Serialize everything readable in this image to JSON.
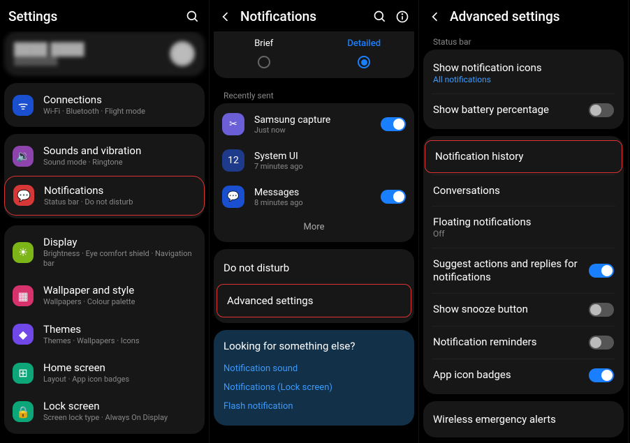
{
  "screen1": {
    "title": "Settings",
    "profile": {
      "name": "████ ████",
      "sub": "████████"
    },
    "items": [
      {
        "title": "Connections",
        "sub": "Wi-Fi  ·  Bluetooth  ·  Flight mode"
      },
      {
        "title": "Sounds and vibration",
        "sub": "Sound mode  ·  Ringtone"
      },
      {
        "title": "Notifications",
        "sub": "Status bar  ·  Do not disturb"
      },
      {
        "title": "Display",
        "sub": "Brightness  ·  Eye comfort shield  ·  Navigation bar"
      },
      {
        "title": "Wallpaper and style",
        "sub": "Wallpapers  ·  Colour palette"
      },
      {
        "title": "Themes",
        "sub": "Themes  ·  Wallpapers  ·  Icons"
      },
      {
        "title": "Home screen",
        "sub": "Layout  ·  App icon badges"
      },
      {
        "title": "Lock screen",
        "sub": "Screen lock type  ·  Always On Display"
      }
    ]
  },
  "screen2": {
    "title": "Notifications",
    "style": {
      "brief": "Brief",
      "detailed": "Detailed"
    },
    "recently_sent_label": "Recently sent",
    "recent": [
      {
        "title": "Samsung capture",
        "sub": "Just now",
        "on": true
      },
      {
        "title": "System UI",
        "sub": "7 minutes ago",
        "on": null
      },
      {
        "title": "Messages",
        "sub": "8 minutes ago",
        "on": true
      }
    ],
    "more": "More",
    "do_not_disturb": "Do not disturb",
    "advanced": "Advanced settings",
    "lookingfor_title": "Looking for something else?",
    "links": [
      "Notification sound",
      "Notifications (Lock screen)",
      "Flash notification"
    ]
  },
  "screen3": {
    "title": "Advanced settings",
    "status_bar_label": "Status bar",
    "items": {
      "show_icons": {
        "title": "Show notification icons",
        "sub": "All notifications"
      },
      "battery": {
        "title": "Show battery percentage",
        "on": false
      },
      "history": {
        "title": "Notification history"
      },
      "conversations": {
        "title": "Conversations"
      },
      "floating": {
        "title": "Floating notifications",
        "sub": "Off"
      },
      "suggest": {
        "title": "Suggest actions and replies for notifications",
        "on": true
      },
      "snooze": {
        "title": "Show snooze button",
        "on": false
      },
      "reminders": {
        "title": "Notification reminders",
        "on": false
      },
      "badges": {
        "title": "App icon badges",
        "on": true
      },
      "emergency": {
        "title": "Wireless emergency alerts"
      }
    }
  }
}
